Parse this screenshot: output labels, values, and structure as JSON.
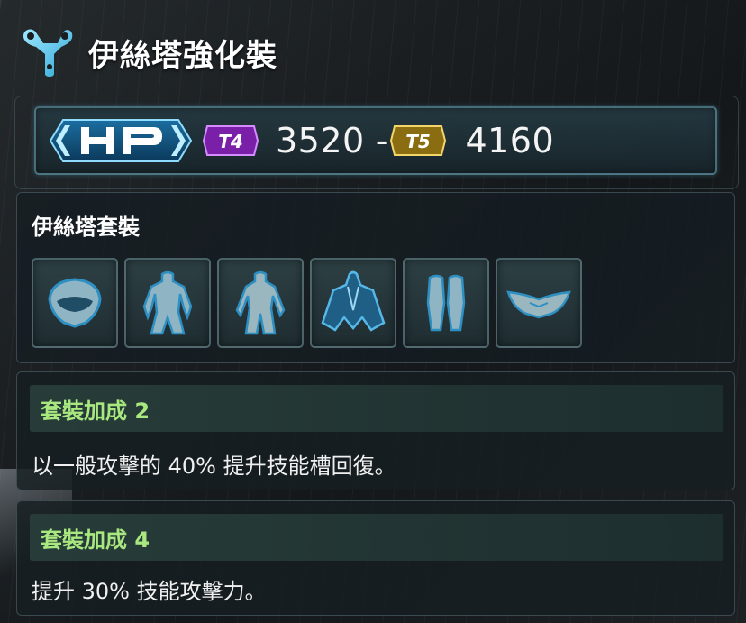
{
  "header": {
    "title": "伊絲塔強化裝",
    "icon": "set-emblem-icon"
  },
  "hp": {
    "icon": "hp-icon",
    "tier_low_label": "T4",
    "tier_low_value": "3520",
    "separator": "-",
    "tier_high_label": "T5",
    "tier_high_value": "4160",
    "colors": {
      "t4": "#9c2bd0",
      "t5": "#c9a62a",
      "accent": "#6fd3f0"
    }
  },
  "set": {
    "name": "伊絲塔套裝",
    "pieces": [
      {
        "icon": "helmet-icon"
      },
      {
        "icon": "armor-body-icon"
      },
      {
        "icon": "suit-icon"
      },
      {
        "icon": "cape-coat-icon"
      },
      {
        "icon": "leggings-icon"
      },
      {
        "icon": "wings-icon"
      }
    ]
  },
  "bonuses": [
    {
      "title": "套裝加成 2",
      "description": "以一般攻擊的 40% 提升技能槽回復。"
    },
    {
      "title": "套裝加成 4",
      "description": "提升 30% 技能攻擊力。"
    }
  ],
  "colors": {
    "bonus_title": "#a9e77f",
    "panel_border": "#6e8c94"
  }
}
